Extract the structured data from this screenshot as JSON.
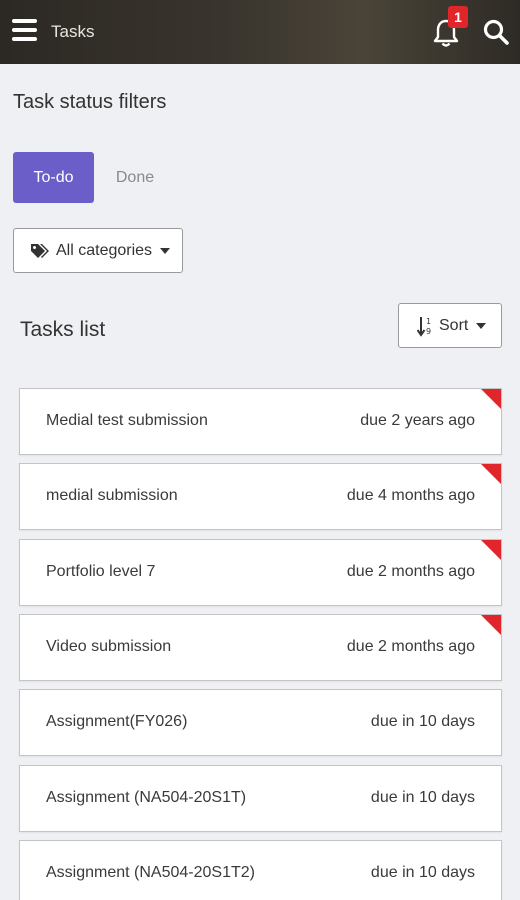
{
  "header": {
    "title": "Tasks",
    "notification_count": "1",
    "menu_icon": "hamburger-icon",
    "bell_icon": "bell-icon",
    "search_icon": "search-icon"
  },
  "filters": {
    "title": "Task status filters",
    "tabs": [
      {
        "label": "To-do",
        "active": true
      },
      {
        "label": "Done",
        "active": false
      }
    ],
    "categories_label": "All categories",
    "categories_icon": "tags-icon"
  },
  "list": {
    "title": "Tasks list",
    "sort_label": "Sort",
    "sort_icon": "sort-numeric-icon",
    "tasks": [
      {
        "name": "Medial test submission",
        "due": "due 2 years ago",
        "overdue": true
      },
      {
        "name": "medial submission",
        "due": "due 4 months ago",
        "overdue": true
      },
      {
        "name": "Portfolio level 7",
        "due": "due 2 months ago",
        "overdue": true
      },
      {
        "name": "Video submission",
        "due": "due 2 months ago",
        "overdue": true
      },
      {
        "name": "Assignment(FY026)",
        "due": "due in 10 days",
        "overdue": false
      },
      {
        "name": "Assignment (NA504-20S1T)",
        "due": "due in 10 days",
        "overdue": false
      },
      {
        "name": "Assignment (NA504-20S1T2)",
        "due": "due in 10 days",
        "overdue": false
      }
    ]
  },
  "colors": {
    "accent": "#6c5ec8",
    "overdue": "#e0262b",
    "header_bg": "#3a352e"
  }
}
